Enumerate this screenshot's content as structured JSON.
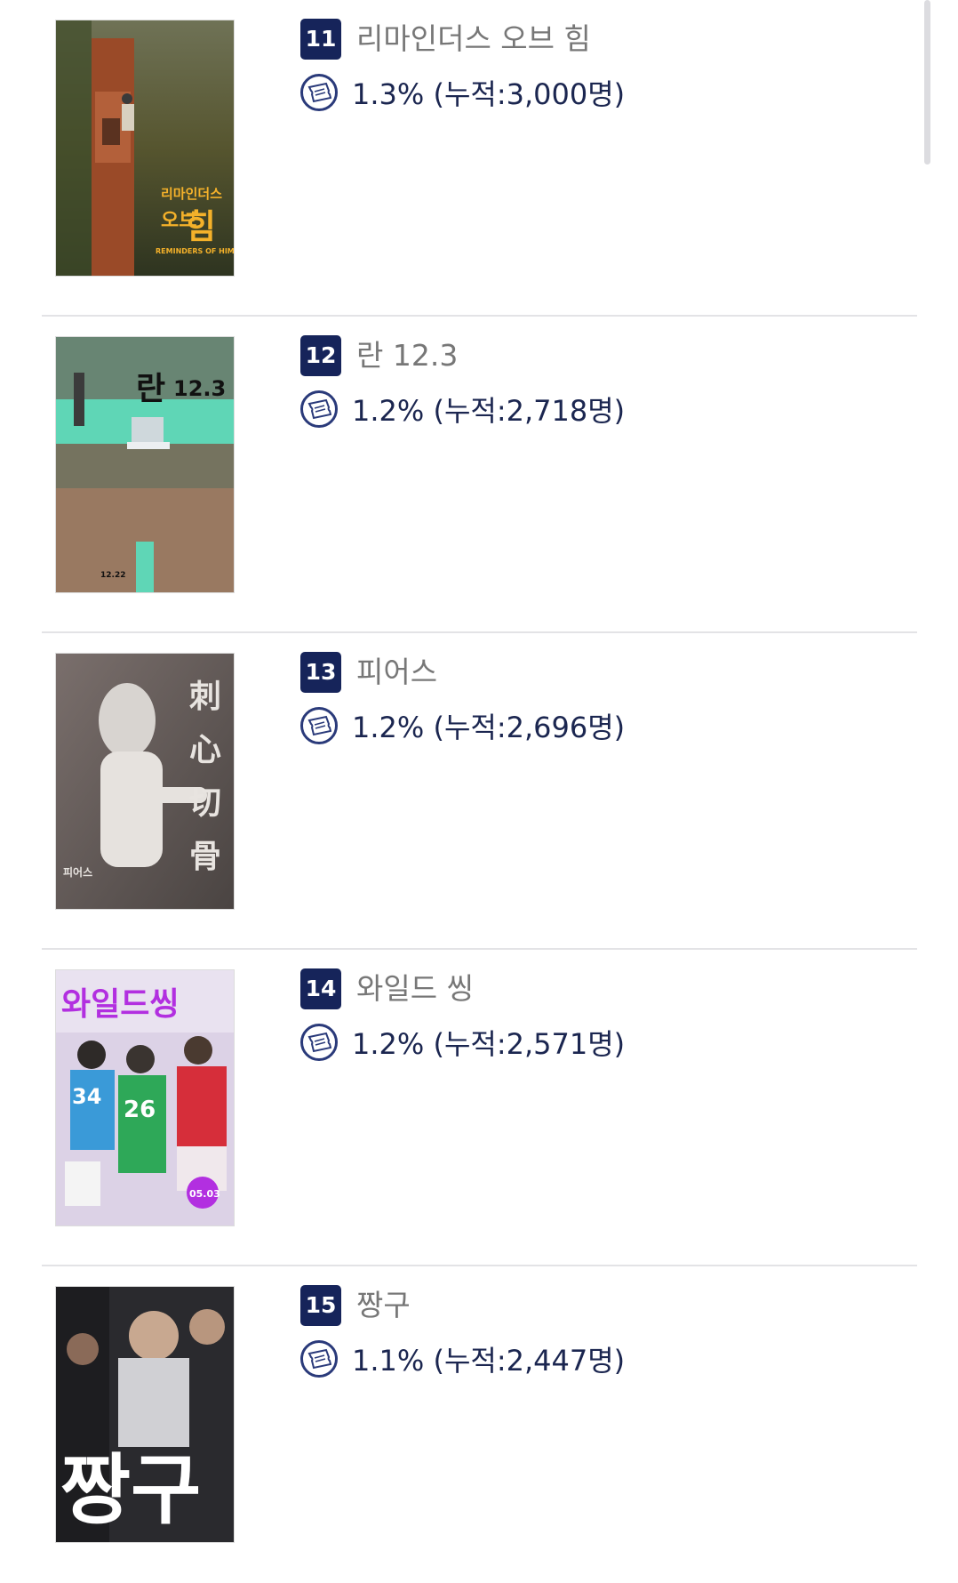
{
  "movies": [
    {
      "rank": "11",
      "title": "리마인더스 오브 힘",
      "stat": "1.3% (누적:3,000명)",
      "poster": {
        "theme": "field-truck",
        "bg": "#5b5a3a",
        "accent": "#f4b12a",
        "texts": [
          "리마인더스",
          "오브",
          "힘",
          "REMINDERS OF HIM"
        ]
      }
    },
    {
      "rank": "12",
      "title": "란 12.3",
      "stat": "1.2% (누적:2,718명)",
      "poster": {
        "theme": "crowd",
        "bg": "#5fd6b6",
        "accent": "#111111",
        "texts": [
          "란",
          "12.3",
          "12.22"
        ]
      }
    },
    {
      "rank": "13",
      "title": "피어스",
      "stat": "1.2% (누적:2,696명)",
      "poster": {
        "theme": "fencer",
        "bg": "#6a6260",
        "accent": "#e8e4e0",
        "texts": [
          "刺",
          "心",
          "切",
          "骨",
          "피어스"
        ]
      }
    },
    {
      "rank": "14",
      "title": "와일드 씽",
      "stat": "1.2% (누적:2,571명)",
      "poster": {
        "theme": "wild",
        "bg": "#dcd2e6",
        "accent": "#b22fe0",
        "texts": [
          "와일드씽",
          "34",
          "26",
          "05.03"
        ]
      }
    },
    {
      "rank": "15",
      "title": "짱구",
      "stat": "1.1% (누적:2,447명)",
      "poster": {
        "theme": "jjang",
        "bg": "#2a2a2e",
        "accent": "#ffffff",
        "texts": [
          "짱구"
        ]
      }
    }
  ],
  "icons": {
    "ticket": "ticket-icon"
  },
  "colors": {
    "rank_bg": "#16245a",
    "title": "#777777",
    "stat": "#1b2650"
  }
}
